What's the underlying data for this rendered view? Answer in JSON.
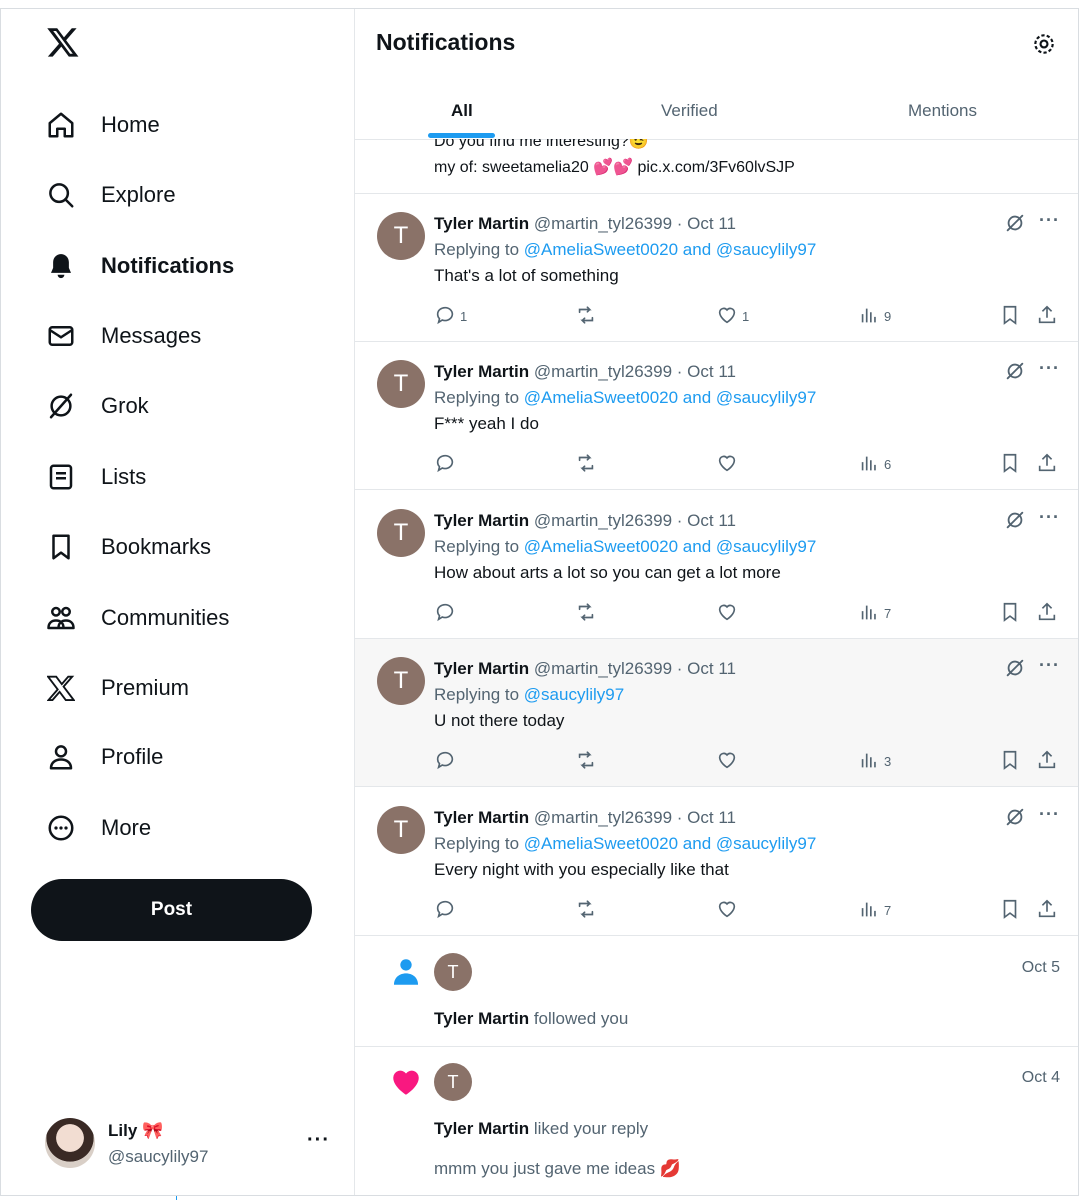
{
  "sidebar": {
    "logo": "x-logo-icon",
    "items": [
      {
        "label": "Home",
        "icon": "home-icon"
      },
      {
        "label": "Explore",
        "icon": "search-icon"
      },
      {
        "label": "Notifications",
        "icon": "bell-icon",
        "active": true
      },
      {
        "label": "Messages",
        "icon": "mail-icon"
      },
      {
        "label": "Grok",
        "icon": "grok-icon"
      },
      {
        "label": "Lists",
        "icon": "list-icon"
      },
      {
        "label": "Bookmarks",
        "icon": "bookmark-icon"
      },
      {
        "label": "Communities",
        "icon": "communities-icon"
      },
      {
        "label": "Premium",
        "icon": "x-premium-icon"
      },
      {
        "label": "Profile",
        "icon": "profile-icon"
      },
      {
        "label": "More",
        "icon": "more-circle-icon"
      }
    ],
    "post_label": "Post",
    "account": {
      "name": "Lily 🎀",
      "handle": "@saucylily97"
    }
  },
  "main": {
    "title": "Notifications",
    "tabs": [
      {
        "label": "All",
        "active": true
      },
      {
        "label": "Verified"
      },
      {
        "label": "Mentions"
      }
    ],
    "partial_tweet": {
      "line1": "Do you find me interesting?😉",
      "line2": "my of: sweetamelia20 💕💕 pic.x.com/3Fv60lvSJP"
    },
    "tweets": [
      {
        "avatar": "T",
        "name": "Tyler Martin",
        "handle": "@martin_tyl26399",
        "date": "· Oct 11",
        "replying_prefix": "Replying to ",
        "replying_to": "@AmeliaSweet0020 and @saucylily97",
        "text": "That's a lot of something",
        "replies": "1",
        "likes": "1",
        "views": "9"
      },
      {
        "avatar": "T",
        "name": "Tyler Martin",
        "handle": "@martin_tyl26399",
        "date": "· Oct 11",
        "replying_prefix": "Replying to ",
        "replying_to": "@AmeliaSweet0020 and @saucylily97",
        "text": "F*** yeah I do",
        "replies": "",
        "likes": "",
        "views": "6"
      },
      {
        "avatar": "T",
        "name": "Tyler Martin",
        "handle": "@martin_tyl26399",
        "date": "· Oct 11",
        "replying_prefix": "Replying to ",
        "replying_to": "@AmeliaSweet0020 and @saucylily97",
        "text": "How about arts a lot so you can get a lot more",
        "replies": "",
        "likes": "",
        "views": "7"
      },
      {
        "avatar": "T",
        "name": "Tyler Martin",
        "handle": "@martin_tyl26399",
        "date": "· Oct 11",
        "replying_prefix": "Replying to ",
        "replying_to": "@saucylily97",
        "text": "U not there today",
        "replies": "",
        "likes": "",
        "views": "3"
      },
      {
        "avatar": "T",
        "name": "Tyler Martin",
        "handle": "@martin_tyl26399",
        "date": "· Oct 11",
        "replying_prefix": "Replying to ",
        "replying_to": "@AmeliaSweet0020 and @saucylily97",
        "text": "Every night with you especially like that",
        "replies": "",
        "likes": "",
        "views": "7"
      }
    ],
    "notifications": [
      {
        "type": "follow",
        "icon": "person-icon",
        "avatar": "T",
        "date": "Oct 5",
        "name": "Tyler Martin",
        "action": " followed you",
        "sub": ""
      },
      {
        "type": "like",
        "icon": "heart-icon",
        "avatar": "T",
        "date": "Oct 4",
        "name": "Tyler Martin",
        "action": " liked your reply",
        "sub": "mmm you just gave me ideas 💋"
      }
    ]
  },
  "colors": {
    "accent": "#1d9bf0",
    "text": "#0f1419",
    "muted": "#536471",
    "like_pink": "#f91880",
    "avatar_bg": "#8a7268"
  }
}
